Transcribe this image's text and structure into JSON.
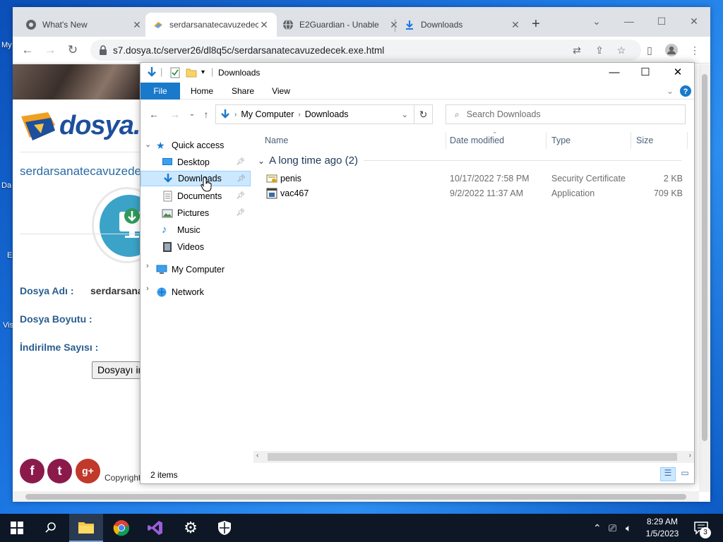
{
  "desktop": {
    "labels": [
      "My",
      "Da",
      "E",
      "Vis"
    ]
  },
  "browser": {
    "tabs": [
      {
        "title": "What's New",
        "icon": "chrome-icon"
      },
      {
        "title": "serdarsanatecavuzedecek",
        "icon": "page-favicon",
        "active": true
      },
      {
        "title": "E2Guardian - Unable",
        "icon": "globe-icon"
      },
      {
        "title": "Downloads",
        "icon": "download-icon"
      }
    ],
    "url": "s7.dosya.tc/server26/dl8q5c/serdarsanatecavuzedecek.exe.html"
  },
  "webpage": {
    "logo_text": "dosya.tc",
    "filename_heading": "serdarsanatecavuzedecek",
    "fields": {
      "name_label": "Dosya Adı :",
      "name_value": "serdarsanatecavuzedecek",
      "size_label": "Dosya Boyutu :",
      "downloads_label": "İndirilme Sayısı :"
    },
    "download_button": "Dosyayı indir",
    "social": [
      "f",
      "t",
      "g+"
    ],
    "copyright": "Copyright"
  },
  "explorer": {
    "title": "Downloads",
    "ribbon_tabs": [
      "File",
      "Home",
      "Share",
      "View"
    ],
    "breadcrumb": [
      "My Computer",
      "Downloads"
    ],
    "search_placeholder": "Search Downloads",
    "nav": {
      "quick_access": "Quick access",
      "items": [
        {
          "label": "Desktop",
          "pinned": true
        },
        {
          "label": "Downloads",
          "pinned": true,
          "selected": true
        },
        {
          "label": "Documents",
          "pinned": true
        },
        {
          "label": "Pictures",
          "pinned": true
        },
        {
          "label": "Music",
          "pinned": false
        },
        {
          "label": "Videos",
          "pinned": false
        }
      ],
      "my_computer": "My Computer",
      "network": "Network"
    },
    "columns": [
      "Name",
      "Date modified",
      "Type",
      "Size"
    ],
    "group_label": "A long time ago (2)",
    "files": [
      {
        "name": "penis",
        "date": "10/17/2022 7:58 PM",
        "type": "Security Certificate",
        "size": "2 KB",
        "icon": "certificate-icon"
      },
      {
        "name": "vac467",
        "date": "9/2/2022 11:37 AM",
        "type": "Application",
        "size": "709 KB",
        "icon": "application-icon"
      }
    ],
    "status": "2 items"
  },
  "taskbar": {
    "time": "8:29 AM",
    "date": "1/5/2023",
    "notification_count": "3"
  },
  "colors": {
    "accent": "#1979ca",
    "selection": "#cce8ff",
    "link": "#2a6aa6"
  }
}
